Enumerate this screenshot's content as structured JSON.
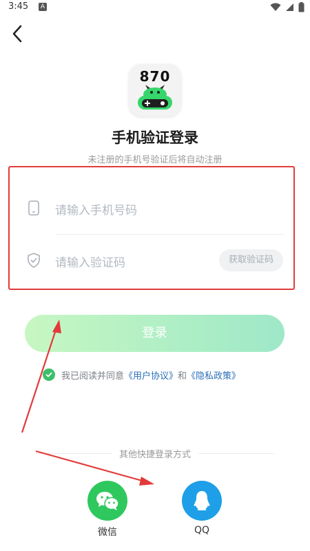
{
  "status_bar": {
    "time": "3:45",
    "notification_icon": "a-notification-icon",
    "wifi_icon": "wifi-icon",
    "signal_icon": "signal-icon",
    "battery_icon": "battery-icon"
  },
  "header": {
    "back_icon": "back-arrow-icon"
  },
  "logo": {
    "number": "870",
    "icon": "monster-gamepad-icon"
  },
  "title": "手机验证登录",
  "subtitle": "未注册的手机号验证后将自动注册",
  "form": {
    "phone": {
      "placeholder": "请输入手机号码",
      "icon": "phone-icon"
    },
    "code": {
      "placeholder": "请输入验证码",
      "icon": "shield-icon",
      "get_code_label": "获取验证码"
    }
  },
  "login_button": "登录",
  "agreement": {
    "prefix": "我已阅读并同意",
    "user_agreement": "《用户协议》",
    "and": "和",
    "privacy_policy": "《隐私政策》",
    "checked": true
  },
  "other_login": {
    "label": "其他快捷登录方式",
    "options": [
      {
        "label": "微信",
        "icon": "wechat-icon",
        "color": "#2fc85e"
      },
      {
        "label": "QQ",
        "icon": "qq-icon",
        "color": "#1f9fe8"
      }
    ]
  },
  "colors": {
    "annotation_red": "#e23a3a",
    "login_gradient_start": "#c7f7c2",
    "login_gradient_end": "#9ee8c8",
    "link": "#2a6fb8"
  }
}
